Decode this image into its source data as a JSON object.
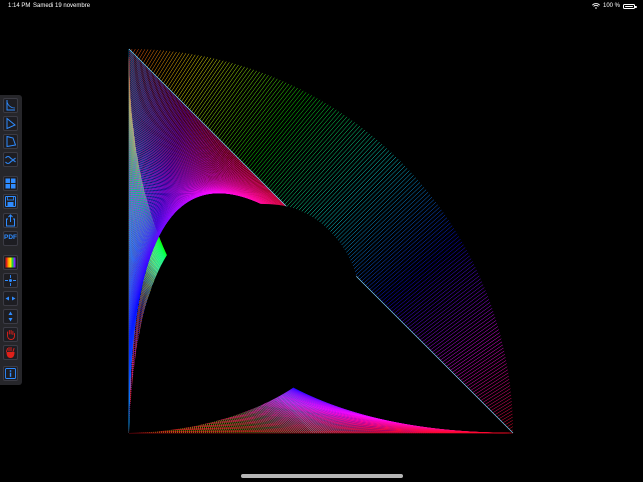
{
  "status_bar": {
    "time": "1:14 PM",
    "date": "Samedi 19 novembre",
    "battery_text": "100 %",
    "wifi_icon": "wifi-icon",
    "battery_icon": "battery-full-icon"
  },
  "toolbar": {
    "tools": [
      {
        "name": "curve-tool-1",
        "icon": "angle-curve-icon"
      },
      {
        "name": "curve-tool-2",
        "icon": "triangle-icon"
      },
      {
        "name": "curve-tool-3",
        "icon": "quadrilateral-icon"
      },
      {
        "name": "curve-tool-4",
        "icon": "wave-curve-icon"
      },
      {
        "name": "grid-button",
        "icon": "grid-icon"
      },
      {
        "name": "save-button",
        "icon": "save-disk-icon"
      },
      {
        "name": "share-button",
        "icon": "share-icon"
      },
      {
        "name": "pdf-button",
        "icon": "pdf-icon",
        "label": "PDF"
      },
      {
        "name": "color-palette-button",
        "icon": "color-bars-icon"
      },
      {
        "name": "zoom-fit-button",
        "icon": "fit-arrows-icon"
      },
      {
        "name": "flip-horizontal-button",
        "icon": "flip-horizontal-icon"
      },
      {
        "name": "flip-vertical-button",
        "icon": "flip-vertical-icon"
      },
      {
        "name": "hand-tool-button",
        "icon": "hand-outline-icon"
      },
      {
        "name": "hand-tool-active-button",
        "icon": "hand-filled-icon"
      },
      {
        "name": "info-button",
        "icon": "info-icon"
      }
    ]
  },
  "colors": {
    "background": "#000000",
    "toolbar_bg": "#26262a",
    "accent_blue": "#2f8cff",
    "accent_red": "#e0201a"
  },
  "artwork": {
    "description_free": true,
    "line_count": 190
  }
}
